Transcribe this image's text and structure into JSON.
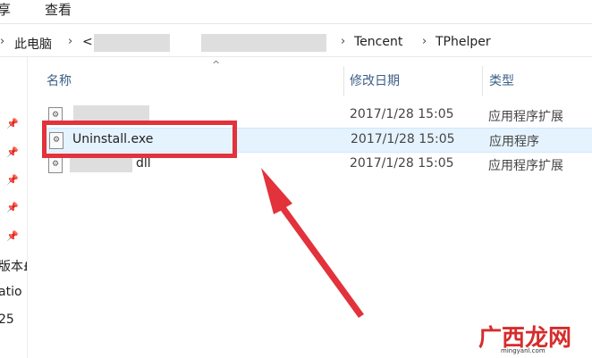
{
  "ribbon": {
    "tabs": [
      "享",
      "查看"
    ]
  },
  "address": {
    "this_pc": "此电脑",
    "partial": "<",
    "seg1": "Tencent",
    "seg2": "TPhelper"
  },
  "nav": {
    "items": [
      "版本£",
      "atio",
      "25"
    ]
  },
  "header": {
    "name": "名称",
    "date": "修改日期",
    "type": "类型"
  },
  "files": [
    {
      "name": "",
      "date": "2017/1/28 15:05",
      "type": "应用程序扩展"
    },
    {
      "name": "Uninstall.exe",
      "date": "2017/1/28 15:05",
      "type": "应用程序"
    },
    {
      "name": "dll",
      "date": "2017/1/28 15:05",
      "type": "应用程序扩展"
    }
  ],
  "watermark": {
    "text": "广西龙网",
    "url": "mingyanl.com"
  },
  "colors": {
    "highlight": "#e2323b",
    "selection": "#e5f3ff",
    "header_text": "#3c5f86"
  }
}
